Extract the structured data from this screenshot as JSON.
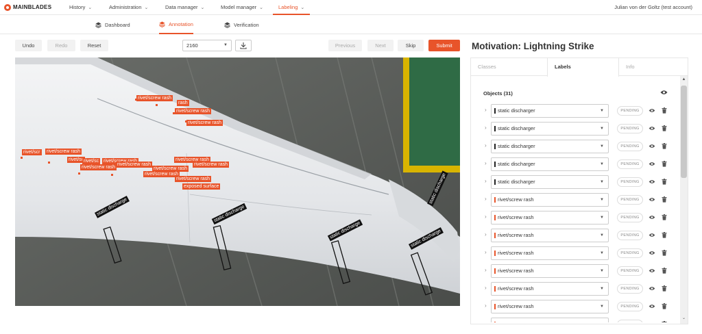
{
  "nav": {
    "logo_text": "MAINBLADES",
    "items": [
      {
        "label": "History",
        "active": false
      },
      {
        "label": "Administration",
        "active": false
      },
      {
        "label": "Data manager",
        "active": false
      },
      {
        "label": "Model manager",
        "active": false
      },
      {
        "label": "Labeling",
        "active": true
      }
    ],
    "user": "Julian von der Goltz (test account)"
  },
  "subtabs": [
    {
      "label": "Dashboard",
      "icon": "layers-icon",
      "active": false
    },
    {
      "label": "Annotation",
      "icon": "layers-icon",
      "active": true
    },
    {
      "label": "Verification",
      "icon": "layers-icon",
      "active": false
    }
  ],
  "toolbar": {
    "undo": "Undo",
    "redo": "Redo",
    "reset": "Reset",
    "image_select_value": "2160",
    "previous": "Previous",
    "next": "Next",
    "skip": "Skip",
    "submit": "Submit",
    "download_icon": "download-icon"
  },
  "viewer": {
    "labels": [
      {
        "text": "rivet/screw rash",
        "type": "orange"
      },
      {
        "text": "rash",
        "type": "orange"
      },
      {
        "text": "rivet/screw rash",
        "type": "orange"
      },
      {
        "text": "rivet/screw rash",
        "type": "orange"
      },
      {
        "text": "rivet/scr",
        "type": "orange"
      },
      {
        "text": "rivet/screw rash",
        "type": "orange"
      },
      {
        "text": "rivet/sc",
        "type": "orange"
      },
      {
        "text": "rivet/sc",
        "type": "orange"
      },
      {
        "text": "rivet/screw rash",
        "type": "orange"
      },
      {
        "text": "rivet/screw rash",
        "type": "orange"
      },
      {
        "text": "rivet/screw rash",
        "type": "orange"
      },
      {
        "text": "rivet/screw rash",
        "type": "orange"
      },
      {
        "text": "rivet/screw rash",
        "type": "orange"
      },
      {
        "text": "rivet/screw rash",
        "type": "orange"
      },
      {
        "text": "rivet/screw rash",
        "type": "orange"
      },
      {
        "text": "rivet/screw rash",
        "type": "orange"
      },
      {
        "text": "exposed surface",
        "type": "orange"
      },
      {
        "text": "static discharge",
        "type": "dark"
      },
      {
        "text": "static discharge",
        "type": "dark"
      },
      {
        "text": "static discharge",
        "type": "dark"
      },
      {
        "text": "static discharge",
        "type": "dark"
      },
      {
        "text": "static discharge",
        "type": "dark"
      }
    ]
  },
  "panel": {
    "title": "Motivation: Lightning Strike",
    "tabs": [
      {
        "label": "Classes",
        "active": false
      },
      {
        "label": "Labels",
        "active": true
      },
      {
        "label": "Info",
        "active": false
      }
    ],
    "objects_header": "Objects (31)",
    "rows": [
      {
        "label": "static discharger",
        "color": "#222222",
        "status": "PENDING"
      },
      {
        "label": "static discharger",
        "color": "#222222",
        "status": "PENDING"
      },
      {
        "label": "static discharger",
        "color": "#222222",
        "status": "PENDING"
      },
      {
        "label": "static discharger",
        "color": "#222222",
        "status": "PENDING"
      },
      {
        "label": "static discharger",
        "color": "#222222",
        "status": "PENDING"
      },
      {
        "label": "rivet/screw rash",
        "color": "#e8542a",
        "status": "PENDING"
      },
      {
        "label": "rivet/screw rash",
        "color": "#e8542a",
        "status": "PENDING"
      },
      {
        "label": "rivet/screw rash",
        "color": "#e8542a",
        "status": "PENDING"
      },
      {
        "label": "rivet/screw rash",
        "color": "#e8542a",
        "status": "PENDING"
      },
      {
        "label": "rivet/screw rash",
        "color": "#e8542a",
        "status": "PENDING"
      },
      {
        "label": "rivet/screw rash",
        "color": "#e8542a",
        "status": "PENDING"
      },
      {
        "label": "rivet/screw rash",
        "color": "#e8542a",
        "status": "PENDING"
      },
      {
        "label": "",
        "color": "#e8542a",
        "status": "PENDING"
      }
    ]
  },
  "colors": {
    "accent": "#e8542a",
    "static_label_bg": "#111111",
    "hangar_floor": "#5b5e5a",
    "wing": "#e9eaec",
    "green_panel": "#2f6b45",
    "yellow_stripe": "#d8b400"
  }
}
